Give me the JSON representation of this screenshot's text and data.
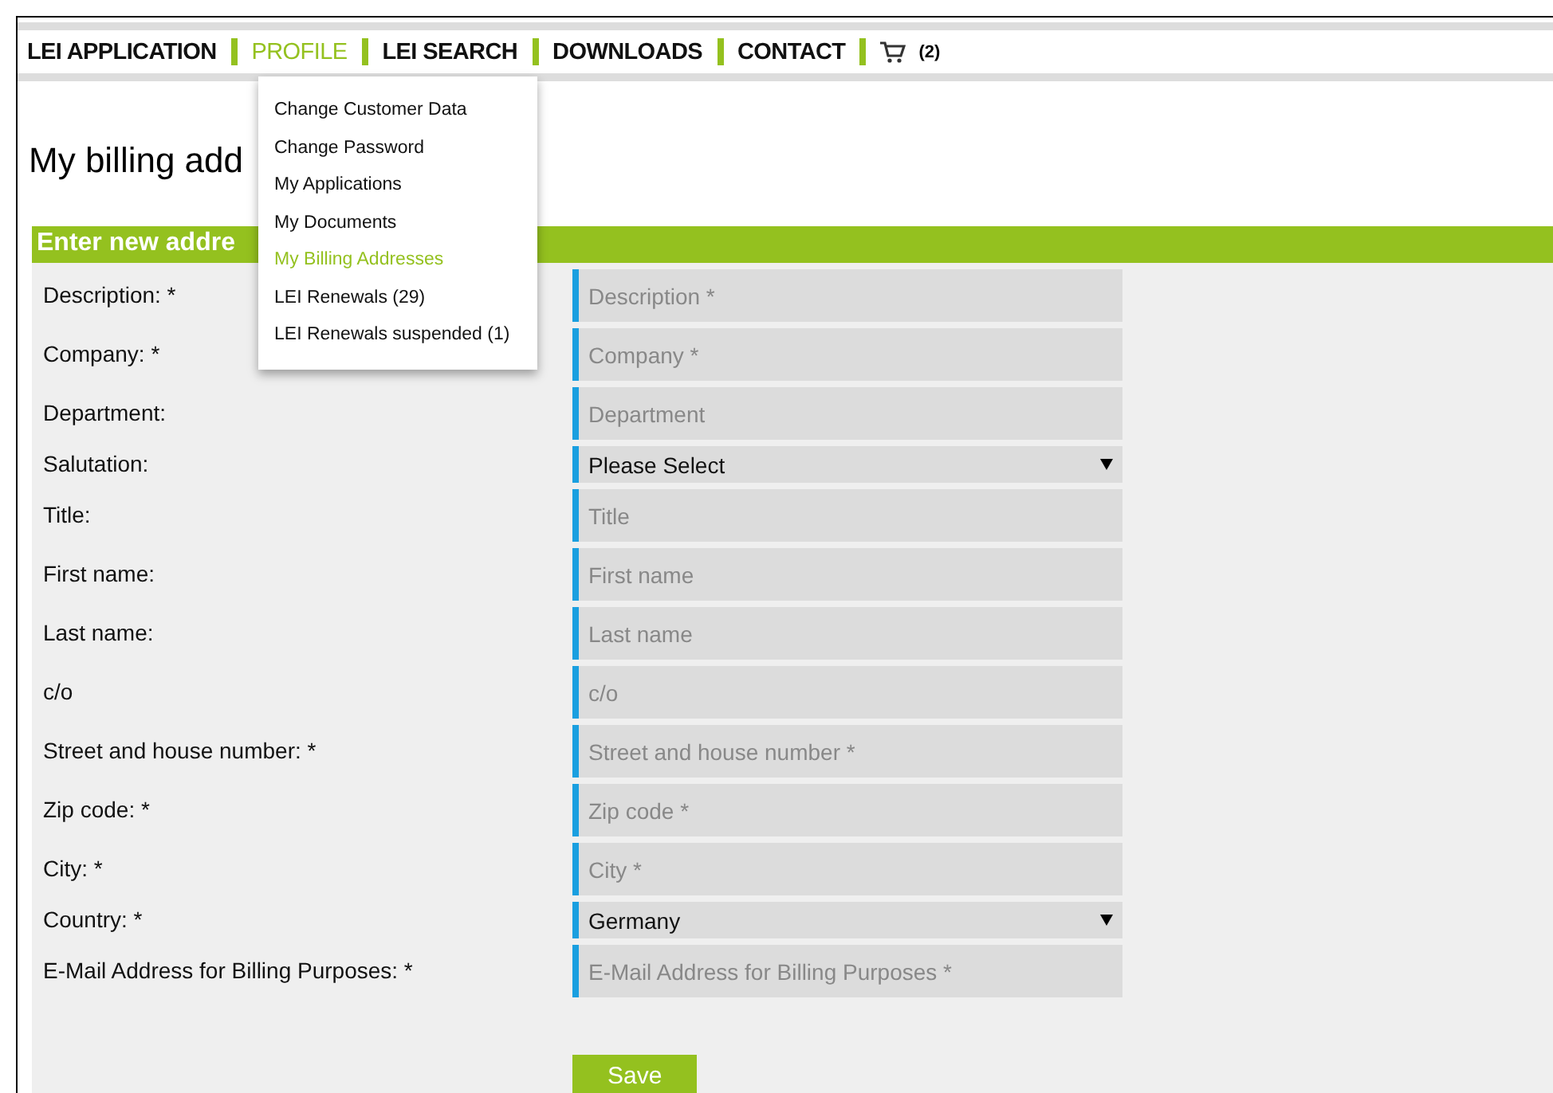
{
  "nav": {
    "items": [
      {
        "label": "LEI APPLICATION",
        "selected": false
      },
      {
        "label": "PROFILE",
        "selected": true
      },
      {
        "label": "LEI SEARCH",
        "selected": false
      },
      {
        "label": "DOWNLOADS",
        "selected": false
      },
      {
        "label": "CONTACT",
        "selected": false
      }
    ],
    "cart_count": "(2)"
  },
  "profile_menu": [
    {
      "label": "Change Customer Data",
      "selected": false
    },
    {
      "label": "Change Password",
      "selected": false
    },
    {
      "label": "My Applications",
      "selected": false
    },
    {
      "label": "My Documents",
      "selected": false
    },
    {
      "label": "My Billing Addresses",
      "selected": true
    },
    {
      "label": "LEI Renewals (29)",
      "selected": false
    },
    {
      "label": "LEI Renewals suspended (1)",
      "selected": false
    }
  ],
  "page_title": "My billing add",
  "form": {
    "header": "Enter new addre",
    "fields": [
      {
        "kind": "input",
        "label": "Description: *",
        "placeholder": "Description *"
      },
      {
        "kind": "input",
        "label": "Company: *",
        "placeholder": "Company *"
      },
      {
        "kind": "input",
        "label": "Department:",
        "placeholder": "Department"
      },
      {
        "kind": "select",
        "label": "Salutation:",
        "value": "Please Select"
      },
      {
        "kind": "input",
        "label": "Title:",
        "placeholder": "Title"
      },
      {
        "kind": "input",
        "label": "First name:",
        "placeholder": "First name"
      },
      {
        "kind": "input",
        "label": "Last name:",
        "placeholder": "Last name"
      },
      {
        "kind": "input",
        "label": "c/o",
        "placeholder": "c/o"
      },
      {
        "kind": "input",
        "label": "Street and house number: *",
        "placeholder": "Street and house number *"
      },
      {
        "kind": "input",
        "label": "Zip code: *",
        "placeholder": "Zip code *"
      },
      {
        "kind": "input",
        "label": "City: *",
        "placeholder": "City *"
      },
      {
        "kind": "select",
        "label": "Country: *",
        "value": "Germany"
      },
      {
        "kind": "input",
        "label": "E-Mail Address for Billing Purposes: *",
        "placeholder": "E-Mail Address for Billing Purposes *"
      }
    ],
    "save_button": "Save"
  }
}
